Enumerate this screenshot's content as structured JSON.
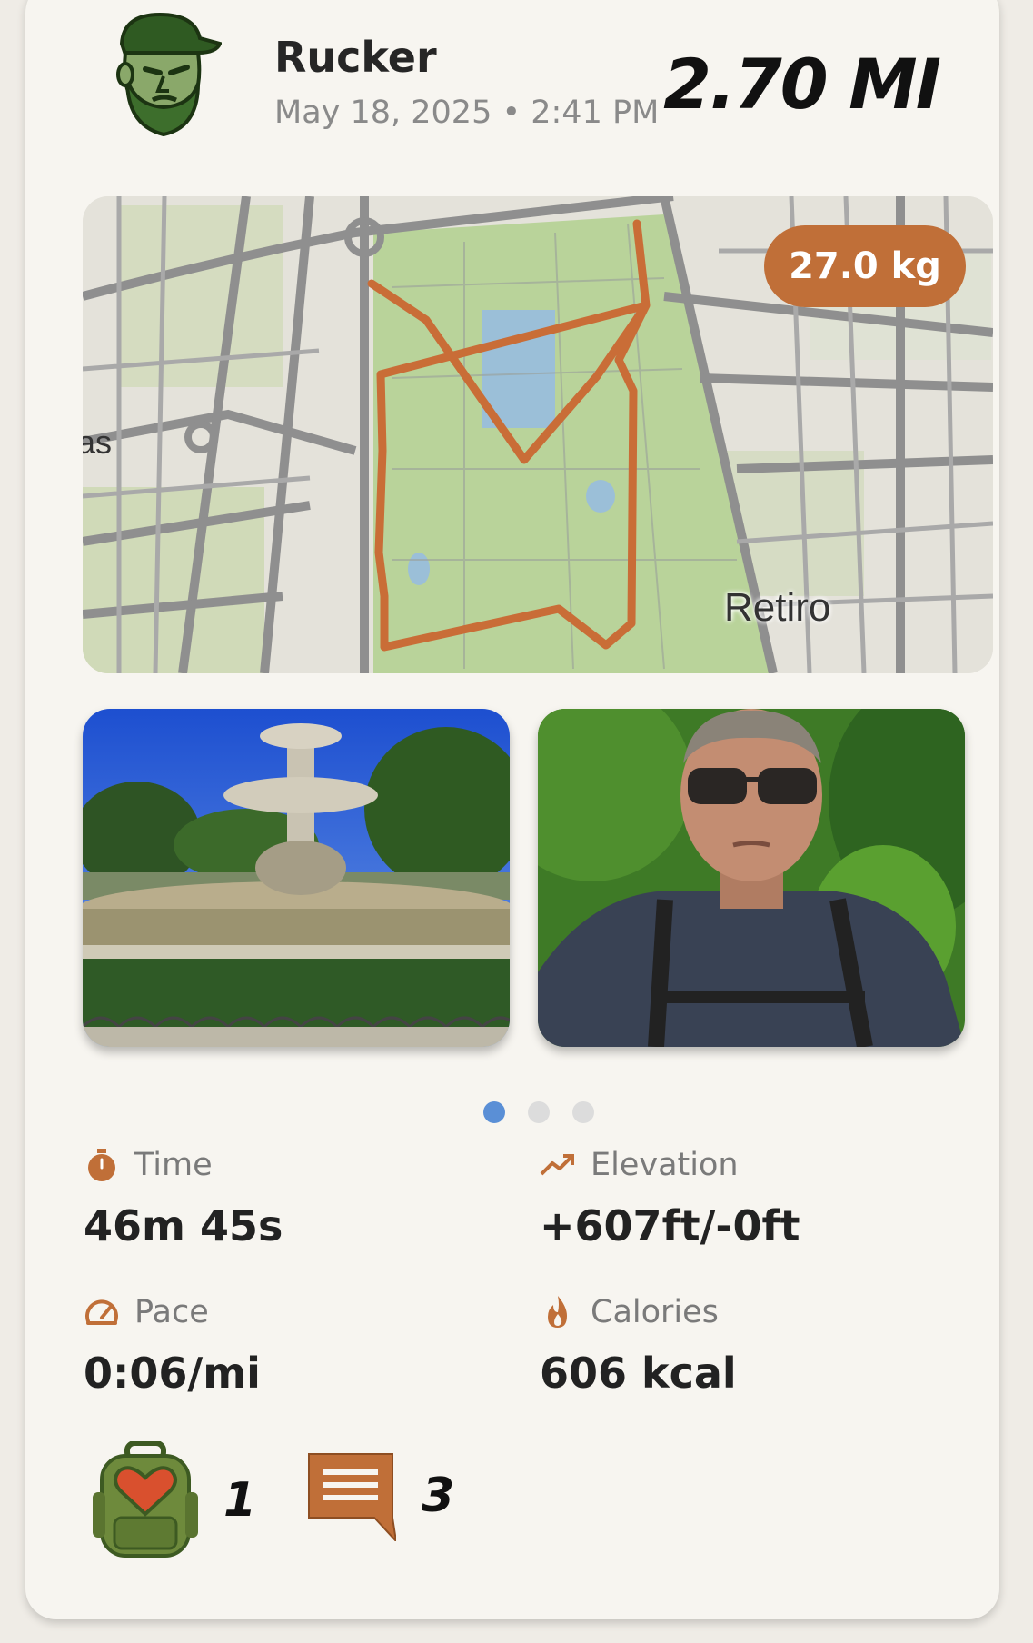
{
  "user": {
    "name": "Rucker",
    "datetime": "May 18, 2025 • 2:41 PM",
    "avatar": "bearded-soldier-avatar"
  },
  "activity": {
    "distance": "2.70 MI",
    "weight": "27.0 kg"
  },
  "map": {
    "place_label": "Retiro",
    "cut_label": "as",
    "route_color": "#c96d37"
  },
  "photos": [
    {
      "subject": "fountain-photo"
    },
    {
      "subject": "selfie-photo"
    }
  ],
  "carousel": {
    "count": 3,
    "active": 0
  },
  "stats": {
    "time": {
      "label": "Time",
      "value": "46m 45s",
      "icon": "stopwatch-icon"
    },
    "elevation": {
      "label": "Elevation",
      "value": "+607ft/-0ft",
      "icon": "trend-up-icon"
    },
    "pace": {
      "label": "Pace",
      "value": "0:06/mi",
      "icon": "speedometer-icon"
    },
    "calories": {
      "label": "Calories",
      "value": "606 kcal",
      "icon": "flame-icon"
    }
  },
  "social": {
    "likes": "1",
    "comments": "3"
  },
  "colors": {
    "accent": "#c06f38",
    "dot_active": "#5a8fd6",
    "background": "#f7f5f0"
  }
}
